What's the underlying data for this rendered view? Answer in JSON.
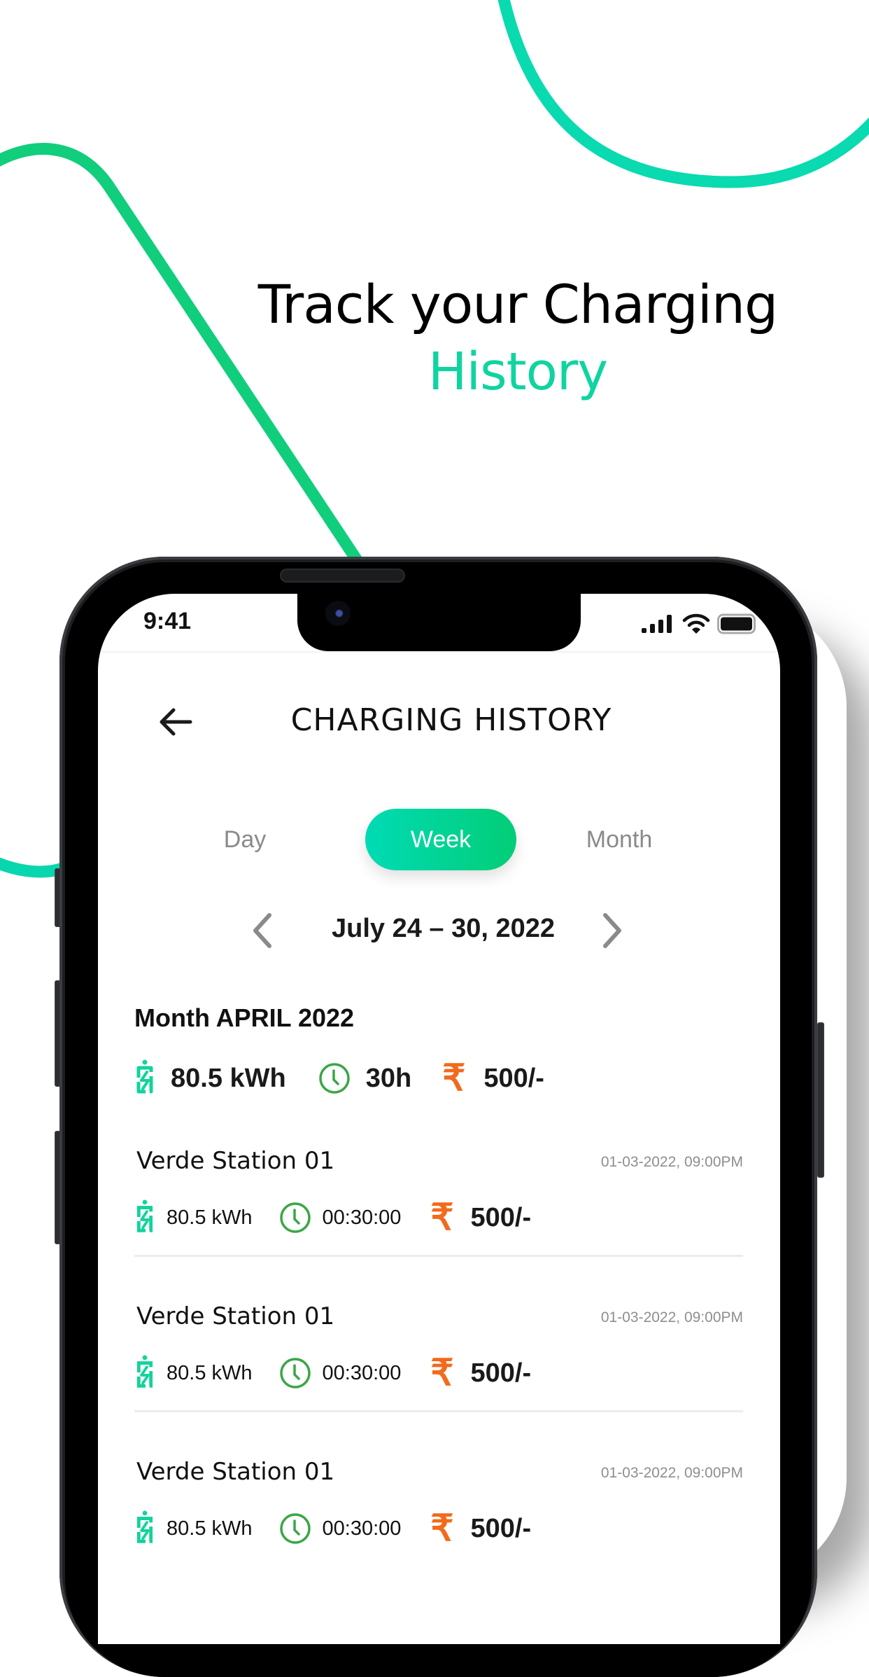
{
  "marketing": {
    "headline_line1": "Track your Charging",
    "headline_line2": "History",
    "accent_color": "#0fd4a0"
  },
  "status_bar": {
    "time": "9:41",
    "icons": [
      "cellular-signal-icon",
      "wifi-icon",
      "battery-icon"
    ]
  },
  "header": {
    "back_icon": "arrow-left-icon",
    "title": "CHARGING HISTORY"
  },
  "period_tabs": {
    "selected": "Week",
    "items": [
      {
        "label": "Day"
      },
      {
        "label": "Week"
      },
      {
        "label": "Month"
      }
    ]
  },
  "date_nav": {
    "prev_icon": "chevron-left-icon",
    "label": "July  24 – 30, 2022",
    "next_icon": "chevron-right-icon"
  },
  "summary": {
    "title": "Month APRIL 2022",
    "energy": "80.5 kWh",
    "duration": "30h",
    "amount": "500/-",
    "currency_symbol": "₹"
  },
  "sessions": [
    {
      "station": "Verde Station 01",
      "timestamp": "01-03-2022, 09:00PM",
      "energy": "80.5 kWh",
      "duration": "00:30:00",
      "amount": "500/-",
      "currency_symbol": "₹"
    },
    {
      "station": "Verde Station 01",
      "timestamp": "01-03-2022, 09:00PM",
      "energy": "80.5 kWh",
      "duration": "00:30:00",
      "amount": "500/-",
      "currency_symbol": "₹"
    },
    {
      "station": "Verde Station 01",
      "timestamp": "01-03-2022, 09:00PM",
      "energy": "80.5 kWh",
      "duration": "00:30:00",
      "amount": "500/-",
      "currency_symbol": "₹"
    }
  ],
  "colors": {
    "energy_icon": "#12d39b",
    "clock_icon": "#3aa647",
    "rupee_icon": "#f26a1b",
    "tab_active_start": "#00dbb5",
    "tab_active_end": "#03cd76"
  }
}
